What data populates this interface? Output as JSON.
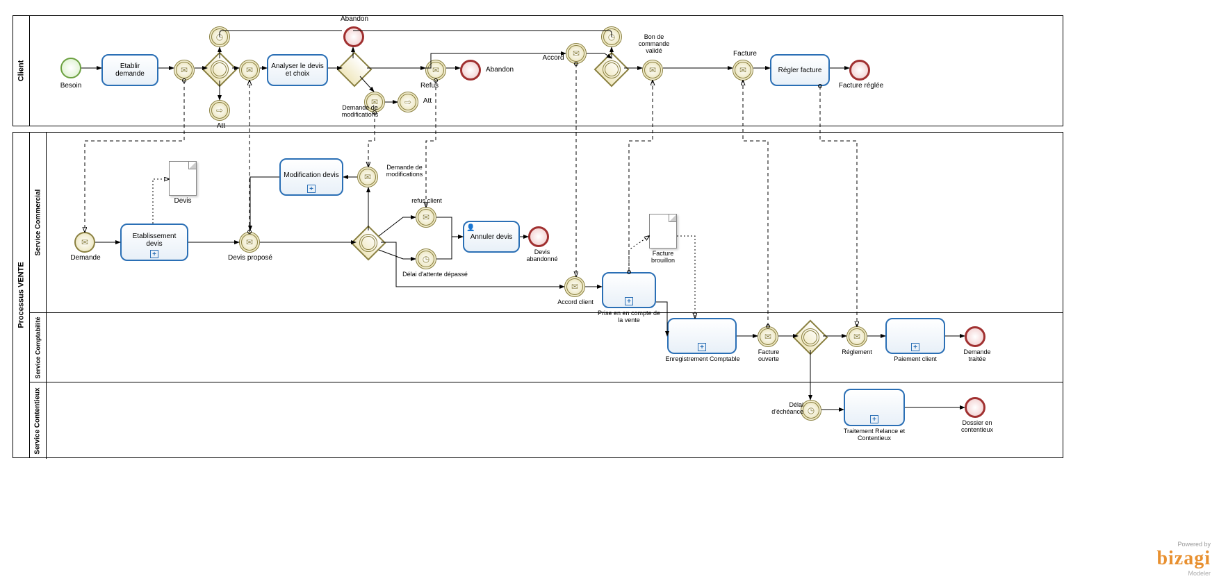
{
  "pools": {
    "client": "Client",
    "vente": "Processus VENTE"
  },
  "lanes": {
    "commercial": "Service Commercial",
    "compta": "Service\nComptabilité",
    "contentieux": "Service Contentieux"
  },
  "tasks": {
    "etablir_demande": "Etablir demande",
    "analyser_devis": "Analyser le devis et choix",
    "regler_facture": "Régler facture",
    "modif_devis": "Modification devis",
    "annuler_devis": "Annuler devis",
    "etablissement_devis": "Etablissement devis",
    "prise_compte": "Prise en en compte de la vente",
    "enreg_compta": "Enregistrement Comptable",
    "paiement_client": "Paiement client",
    "traitement_relance": "Traitement Relance et Contentieux"
  },
  "events": {
    "besoin": "Besoin",
    "att1": "Att",
    "att2": "Att",
    "abandon_top": "Abandon",
    "demande_modif": "Demande de modifications",
    "refus": "Refus",
    "abandon2": "Abandon",
    "accord": "Accord",
    "bon_commande": "Bon de commande validé",
    "facture": "Facture",
    "facture_reglee": "Facture réglée",
    "demande": "Demande",
    "devis": "Devis",
    "devis_propose": "Devis proposé",
    "demande_modif2": "Demande de modifications",
    "refus_client": "refus client",
    "delai_attente": "Délai d'attente dépassé",
    "devis_abandonne": "Devis abandonné",
    "accord_client": "Accord client",
    "facture_brouillon": "Facture brouillon",
    "facture_ouverte": "Facture ouverte",
    "reglement": "Réglement",
    "demande_traitee": "Demande traitée",
    "delai_echeance": "Délai d'échéance",
    "dossier_contentieux": "Dossier en contentieux"
  },
  "watermark": {
    "powered": "Powered by",
    "logo": "bizagi",
    "sub": "Modeler"
  }
}
